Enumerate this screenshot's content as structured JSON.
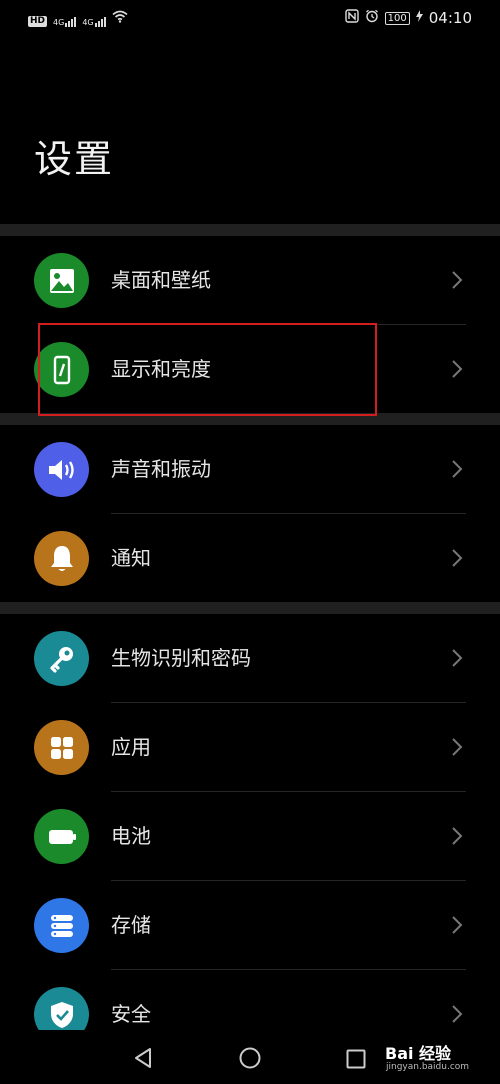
{
  "status_bar": {
    "left_badge": "HD",
    "sim1": "4G",
    "sim2": "4G",
    "battery": "100",
    "time": "04:10",
    "icons": [
      "hd-icon",
      "signal-icon",
      "signal-icon",
      "wifi-icon",
      "nfc-icon",
      "alarm-icon",
      "battery-icon",
      "charging-icon"
    ]
  },
  "page": {
    "title": "设置"
  },
  "groups": [
    {
      "items": [
        {
          "label": "桌面和壁纸",
          "icon": "wallpaper-icon",
          "color": "#1a8a2a"
        },
        {
          "label": "显示和亮度",
          "icon": "display-icon",
          "color": "#1a8a2a"
        }
      ]
    },
    {
      "items": [
        {
          "label": "声音和振动",
          "icon": "sound-icon",
          "color": "#4f5fe8"
        },
        {
          "label": "通知",
          "icon": "bell-icon",
          "color": "#b8741b"
        }
      ]
    },
    {
      "items": [
        {
          "label": "生物识别和密码",
          "icon": "key-icon",
          "color": "#1a8a95"
        },
        {
          "label": "应用",
          "icon": "apps-icon",
          "color": "#b8741b"
        },
        {
          "label": "电池",
          "icon": "battery-icon",
          "color": "#1a8a2a"
        },
        {
          "label": "存储",
          "icon": "storage-icon",
          "color": "#2f77e6"
        },
        {
          "label": "安全",
          "icon": "shield-icon",
          "color": "#1a8a95"
        }
      ]
    }
  ],
  "navigation": {
    "back": "back-icon",
    "home": "home-icon",
    "recent": "recent-apps-icon"
  },
  "watermark": {
    "text": "Bai 经验",
    "url": "jingyan.baidu.com"
  }
}
